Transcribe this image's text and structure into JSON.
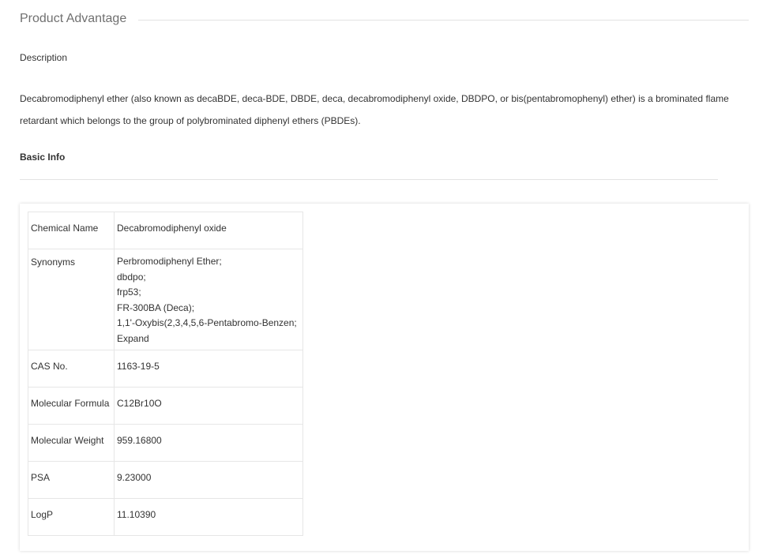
{
  "section": {
    "title": "Product Advantage"
  },
  "description": {
    "heading": "Description",
    "text": "Decabromodiphenyl ether (also known as decaBDE, deca-BDE, DBDE, deca, decabromodiphenyl oxide, DBDPO, or bis(pentabromophenyl) ether) is a brominated flame retardant which belongs to the group of polybrominated diphenyl ethers (PBDEs)."
  },
  "basic_info": {
    "heading": "Basic Info",
    "rows": {
      "chemical_name": {
        "label": "Chemical Name",
        "value": "Decabromodiphenyl oxide"
      },
      "synonyms": {
        "label": "Synonyms",
        "items": [
          "Perbromodiphenyl Ether;",
          "dbdpo;",
          "frp53;",
          "FR-300BA (Deca);",
          "1,1'-Oxybis(2,3,4,5,6-Pentabromo-Benzen;"
        ],
        "expand_label": "Expand"
      },
      "cas_no": {
        "label": "CAS No.",
        "value": "1163-19-5"
      },
      "molecular_formula": {
        "label": "Molecular Formula",
        "value": "C12Br10O"
      },
      "molecular_weight": {
        "label": "Molecular Weight",
        "value": "959.16800"
      },
      "psa": {
        "label": "PSA",
        "value": "9.23000"
      },
      "logp": {
        "label": "LogP",
        "value": "11.10390"
      }
    }
  }
}
